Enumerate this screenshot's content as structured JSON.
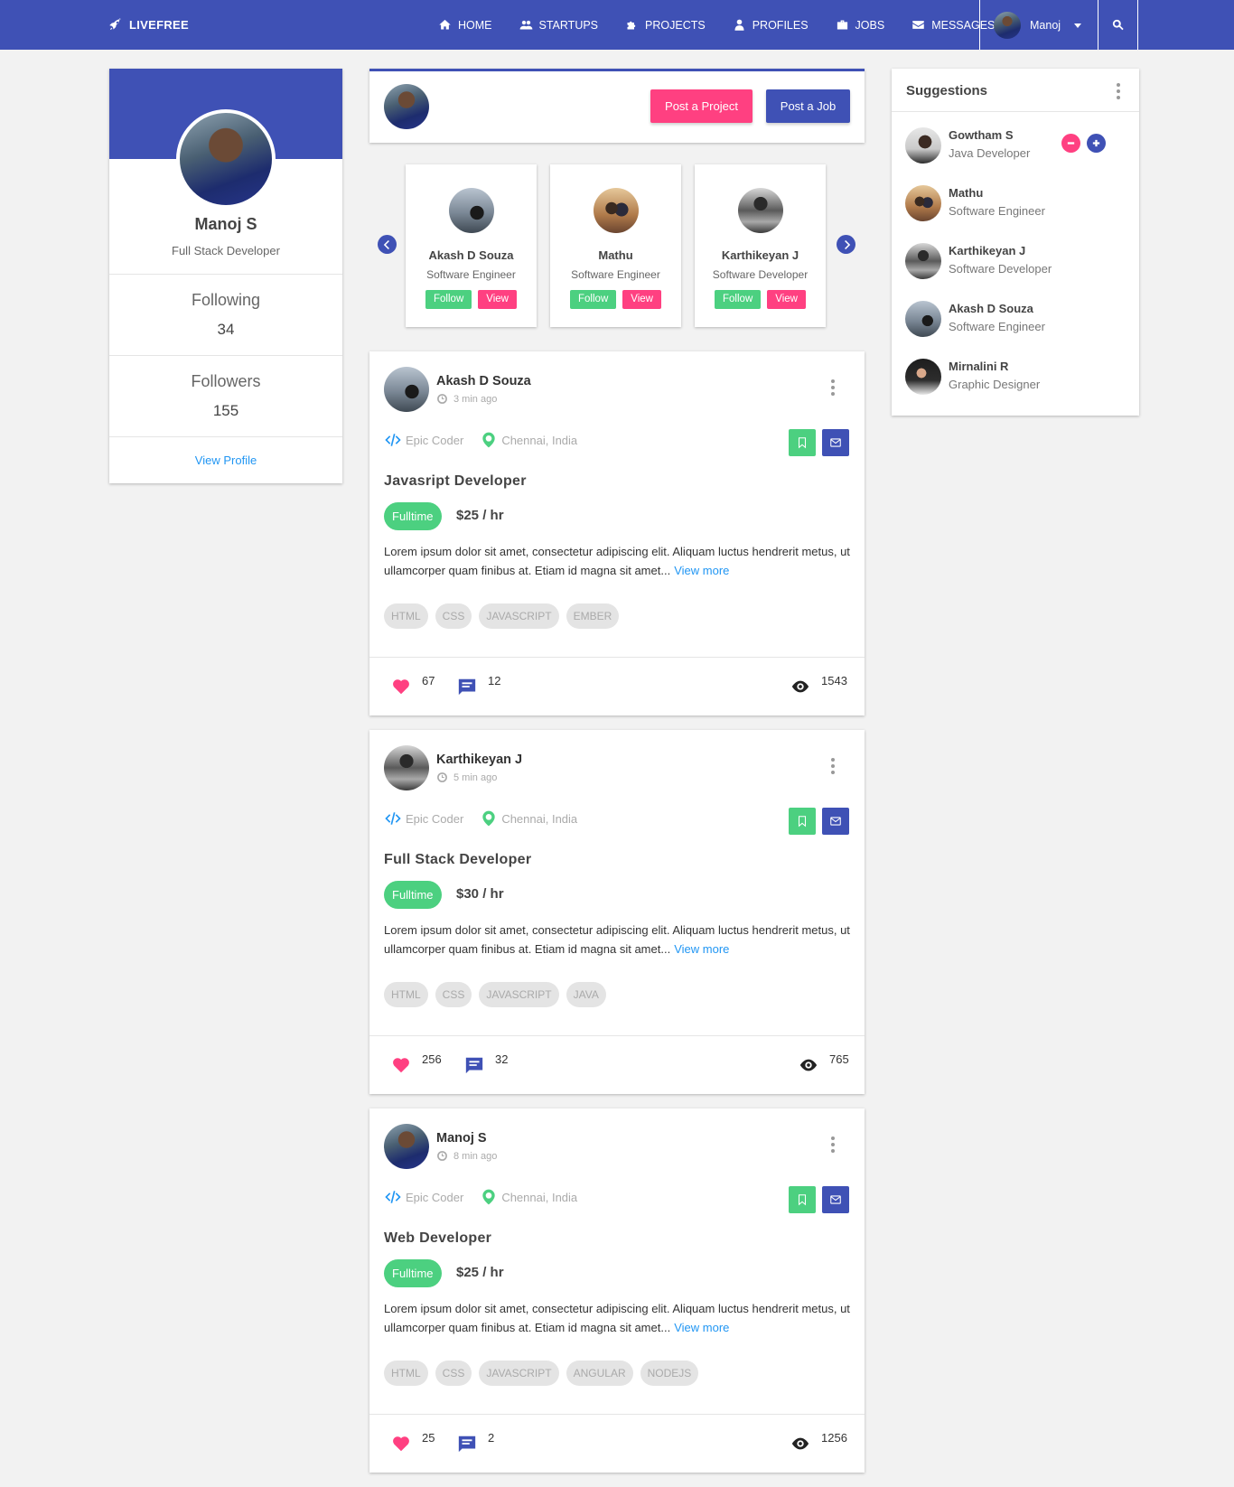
{
  "nav": {
    "brand": "LIVEFREE",
    "items": [
      {
        "label": "HOME",
        "icon": "home-icon"
      },
      {
        "label": "STARTUPS",
        "icon": "users-icon"
      },
      {
        "label": "PROJECTS",
        "icon": "puzzle-icon"
      },
      {
        "label": "PROFILES",
        "icon": "user-icon"
      },
      {
        "label": "JOBS",
        "icon": "briefcase-icon"
      },
      {
        "label": "MESSAGES",
        "icon": "envelope-icon"
      }
    ],
    "user_name": "Manoj"
  },
  "profile": {
    "name": "Manoj S",
    "role": "Full Stack Developer",
    "following_label": "Following",
    "following_count": "34",
    "followers_label": "Followers",
    "followers_count": "155",
    "view_profile_label": "View Profile"
  },
  "post_bar": {
    "post_project_label": "Post a Project",
    "post_job_label": "Post a Job"
  },
  "carousel": {
    "people": [
      {
        "name": "Akash D Souza",
        "role": "Software Engineer"
      },
      {
        "name": "Mathu",
        "role": "Software Engineer"
      },
      {
        "name": "Karthikeyan J",
        "role": "Software Developer"
      }
    ],
    "follow_label": "Follow",
    "view_label": "View"
  },
  "posts": [
    {
      "author": "Akash D Souza",
      "time": "3 min ago",
      "company": "Epic Coder",
      "location": "Chennai, India",
      "title": "Javasript Developer",
      "type": "Fulltime",
      "rate": "$25 / hr",
      "desc": "Lorem ipsum dolor sit amet, consectetur adipiscing elit. Aliquam luctus hendrerit metus, ut ullamcorper quam finibus at. Etiam id magna sit amet...",
      "more": "View more",
      "tags": [
        "HTML",
        "CSS",
        "JAVASCRIPT",
        "EMBER"
      ],
      "likes": "67",
      "comments": "12",
      "views": "1543"
    },
    {
      "author": "Karthikeyan J",
      "time": "5 min ago",
      "company": "Epic Coder",
      "location": "Chennai, India",
      "title": "Full Stack Developer",
      "type": "Fulltime",
      "rate": "$30 / hr",
      "desc": "Lorem ipsum dolor sit amet, consectetur adipiscing elit. Aliquam luctus hendrerit metus, ut ullamcorper quam finibus at. Etiam id magna sit amet...",
      "more": "View more",
      "tags": [
        "HTML",
        "CSS",
        "JAVASCRIPT",
        "JAVA"
      ],
      "likes": "256",
      "comments": "32",
      "views": "765"
    },
    {
      "author": "Manoj S",
      "time": "8 min ago",
      "company": "Epic Coder",
      "location": "Chennai, India",
      "title": "Web Developer",
      "type": "Fulltime",
      "rate": "$25 / hr",
      "desc": "Lorem ipsum dolor sit amet, consectetur adipiscing elit. Aliquam luctus hendrerit metus, ut ullamcorper quam finibus at. Etiam id magna sit amet...",
      "more": "View more",
      "tags": [
        "HTML",
        "CSS",
        "JAVASCRIPT",
        "ANGULAR",
        "NODEJS"
      ],
      "likes": "25",
      "comments": "2",
      "views": "1256"
    }
  ],
  "suggestions": {
    "title": "Suggestions",
    "items": [
      {
        "name": "Gowtham S",
        "role": "Java Developer"
      },
      {
        "name": "Mathu",
        "role": "Software Engineer"
      },
      {
        "name": "Karthikeyan J",
        "role": "Software Developer"
      },
      {
        "name": "Akash D Souza",
        "role": "Software Engineer"
      },
      {
        "name": "Mirnalini R",
        "role": "Graphic Designer"
      }
    ]
  },
  "colors": {
    "primary": "#3f51b5",
    "accent": "#ff4081",
    "success": "#4cd080",
    "link": "#2196f3",
    "background": "#f2f2f2"
  }
}
